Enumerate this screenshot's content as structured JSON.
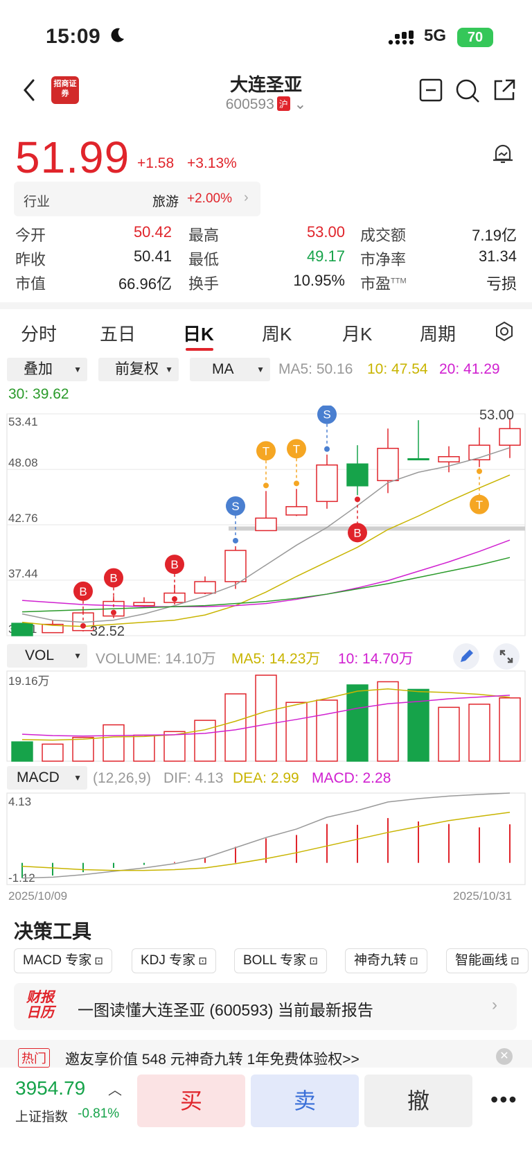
{
  "status_bar": {
    "time": "15:09",
    "network": "5G",
    "battery": "70"
  },
  "header": {
    "stock_name": "大连圣亚",
    "stock_code": "600593",
    "exchange_badge": "沪",
    "broker_logo": "招商证券"
  },
  "quote": {
    "price": "51.99",
    "change": "+1.58",
    "change_pct": "+3.13%",
    "industry": {
      "label": "行业",
      "name": "旅游",
      "pct": "+2.00%"
    },
    "stats": [
      {
        "label": "今开",
        "value": "50.42",
        "color": "#e0242b"
      },
      {
        "label": "最高",
        "value": "53.00",
        "color": "#e0242b"
      },
      {
        "label": "成交额",
        "value": "7.19亿",
        "color": "#222222"
      },
      {
        "label": "昨收",
        "value": "50.41",
        "color": "#222222"
      },
      {
        "label": "最低",
        "value": "49.17",
        "color": "#16a34a"
      },
      {
        "label": "市净率",
        "value": "31.34",
        "color": "#222222"
      },
      {
        "label": "市值",
        "value": "66.96亿",
        "color": "#222222"
      },
      {
        "label": "换手",
        "value": "10.95%",
        "color": "#222222"
      },
      {
        "label": "市盈",
        "value": "亏损",
        "color": "#222222",
        "sup": "TTM"
      }
    ]
  },
  "tabs": [
    "分时",
    "五日",
    "日K",
    "周K",
    "月K",
    "周期"
  ],
  "active_tab": "日K",
  "controls": {
    "overlay": "叠加",
    "adjust": "前复权",
    "indicator": "MA"
  },
  "ma_legend": {
    "ma5": "MA5: 50.16",
    "ma10": "10: 47.54",
    "ma20": "20: 41.29",
    "ma30": "30: 39.62",
    "colors": {
      "ma5": "#999999",
      "ma10": "#c8b400",
      "ma20": "#d020d0",
      "ma30": "#2a9a2a"
    }
  },
  "chart_data": [
    {
      "type": "candlestick",
      "title": "日K",
      "x_range": [
        "2025/10/09",
        "2025/10/31"
      ],
      "ylim": [
        32.11,
        53.41
      ],
      "y_ticks": [
        "53.41",
        "48.08",
        "42.76",
        "37.44",
        "32.11"
      ],
      "annotations": {
        "high_label": "53.00",
        "low_label": "32.52"
      },
      "candles": [
        {
          "o": 32.11,
          "c": 33.3,
          "h": 33.3,
          "l": 32.11,
          "up": false
        },
        {
          "o": 32.4,
          "c": 33.2,
          "h": 33.6,
          "l": 32.4,
          "up": true
        },
        {
          "o": 32.6,
          "c": 34.3,
          "h": 34.6,
          "l": 32.52,
          "up": true
        },
        {
          "o": 34.0,
          "c": 35.4,
          "h": 35.9,
          "l": 33.8,
          "up": true
        },
        {
          "o": 35.0,
          "c": 35.3,
          "h": 35.8,
          "l": 34.9,
          "up": true
        },
        {
          "o": 35.3,
          "c": 36.2,
          "h": 37.0,
          "l": 35.1,
          "up": true
        },
        {
          "o": 36.2,
          "c": 37.3,
          "h": 37.8,
          "l": 36.1,
          "up": true
        },
        {
          "o": 37.3,
          "c": 40.3,
          "h": 40.7,
          "l": 36.6,
          "up": true
        },
        {
          "o": 42.2,
          "c": 43.4,
          "h": 46.0,
          "l": 42.2,
          "up": true
        },
        {
          "o": 43.7,
          "c": 44.5,
          "h": 46.2,
          "l": 43.6,
          "up": true
        },
        {
          "o": 45.0,
          "c": 48.5,
          "h": 49.5,
          "l": 44.3,
          "up": true
        },
        {
          "o": 48.6,
          "c": 46.5,
          "h": 50.4,
          "l": 45.6,
          "up": false
        },
        {
          "o": 47.0,
          "c": 50.1,
          "h": 52.0,
          "l": 45.8,
          "up": true
        },
        {
          "o": 49.1,
          "c": 49.0,
          "h": 52.8,
          "l": 49.0,
          "up": false
        },
        {
          "o": 48.8,
          "c": 49.3,
          "h": 50.3,
          "l": 47.8,
          "up": true
        },
        {
          "o": 49.0,
          "c": 50.4,
          "h": 52.1,
          "l": 48.3,
          "up": true
        },
        {
          "o": 50.4,
          "c": 51.99,
          "h": 53.0,
          "l": 49.17,
          "up": true
        }
      ],
      "series": [
        {
          "name": "MA5",
          "color": "#999999",
          "values": [
            34.2,
            33.6,
            33.4,
            33.6,
            34.2,
            35.0,
            35.9,
            37.0,
            38.9,
            40.8,
            42.5,
            44.6,
            46.8,
            47.8,
            48.4,
            49.2,
            50.16
          ]
        },
        {
          "name": "10",
          "color": "#c8b400",
          "values": [
            33.4,
            33.1,
            33.0,
            33.2,
            33.4,
            33.6,
            34.1,
            35.0,
            36.3,
            37.8,
            39.2,
            40.6,
            42.3,
            43.6,
            45.0,
            46.3,
            47.54
          ]
        },
        {
          "name": "20",
          "color": "#d020d0",
          "values": [
            35.5,
            35.3,
            35.1,
            35.0,
            34.9,
            34.9,
            34.9,
            35.0,
            35.2,
            35.6,
            36.1,
            36.7,
            37.4,
            38.3,
            39.2,
            40.2,
            41.29
          ]
        },
        {
          "name": "30",
          "color": "#2a9a2a",
          "values": [
            34.4,
            34.5,
            34.6,
            34.7,
            34.8,
            34.9,
            35.0,
            35.2,
            35.4,
            35.7,
            36.1,
            36.6,
            37.1,
            37.7,
            38.3,
            38.9,
            39.62
          ]
        }
      ],
      "signals": [
        {
          "i": 2,
          "label": "B"
        },
        {
          "i": 3,
          "label": "B"
        },
        {
          "i": 5,
          "label": "B"
        },
        {
          "i": 7,
          "label": "S"
        },
        {
          "i": 8,
          "label": "T"
        },
        {
          "i": 9,
          "label": "T"
        },
        {
          "i": 10,
          "label": "S"
        },
        {
          "i": 11,
          "label": "B"
        },
        {
          "i": 15,
          "label": "T"
        }
      ]
    },
    {
      "type": "bar",
      "title": "VOL",
      "legend": [
        "VOLUME: 14.10万",
        "MA5: 14.23万",
        "10: 14.70万"
      ],
      "y_top_label": "19.16万",
      "ylim": [
        0,
        19.16
      ],
      "values": [
        4.3,
        3.8,
        5.3,
        8.1,
        5.8,
        6.6,
        9.1,
        15.0,
        19.16,
        13.1,
        13.6,
        17.0,
        17.7,
        16.0,
        12.0,
        12.7,
        14.1
      ],
      "up": [
        false,
        true,
        true,
        true,
        true,
        true,
        true,
        true,
        true,
        true,
        true,
        false,
        true,
        false,
        true,
        true,
        true
      ],
      "series": [
        {
          "name": "MA5",
          "color": "#c8b400",
          "values": [
            4.8,
            4.7,
            4.9,
            5.4,
            5.5,
            5.9,
            7.0,
            8.9,
            11.1,
            12.6,
            14.0,
            15.6,
            16.1,
            15.5,
            15.3,
            14.9,
            14.23
          ]
        },
        {
          "name": "10",
          "color": "#d020d0",
          "values": [
            6.0,
            5.7,
            5.6,
            5.7,
            5.8,
            5.9,
            6.2,
            7.0,
            8.2,
            9.3,
            10.5,
            11.8,
            12.8,
            13.3,
            13.9,
            14.3,
            14.7
          ]
        }
      ]
    },
    {
      "type": "bar",
      "title": "MACD",
      "legend": [
        "(12,26,9)",
        "DIF: 4.13",
        "DEA: 2.99",
        "MACD: 2.28"
      ],
      "ylim": [
        -1.12,
        4.13
      ],
      "y_ticks": [
        "4.13",
        "-1.12"
      ],
      "values": [
        -0.9,
        -0.75,
        -0.55,
        -0.3,
        -0.12,
        0.05,
        0.3,
        0.95,
        1.45,
        1.65,
        2.3,
        2.25,
        2.65,
        2.45,
        2.3,
        2.1,
        2.28
      ],
      "series": [
        {
          "name": "DIF",
          "color": "#999999",
          "values": [
            -0.9,
            -0.85,
            -0.7,
            -0.5,
            -0.3,
            -0.05,
            0.3,
            0.9,
            1.5,
            2.0,
            2.7,
            3.1,
            3.6,
            3.8,
            3.95,
            4.05,
            4.13
          ]
        },
        {
          "name": "DEA",
          "color": "#c8b400",
          "values": [
            -0.2,
            -0.3,
            -0.4,
            -0.45,
            -0.45,
            -0.4,
            -0.3,
            -0.05,
            0.25,
            0.6,
            1.0,
            1.4,
            1.8,
            2.15,
            2.5,
            2.75,
            2.99
          ]
        }
      ]
    }
  ],
  "sub_indicators": {
    "vol": "VOL",
    "macd": "MACD"
  },
  "date_start": "2025/10/09",
  "date_end": "2025/10/31",
  "tools": {
    "title": "决策工具",
    "chips": [
      "MACD 专家",
      "KDJ 专家",
      "BOLL 专家",
      "神奇九转",
      "智能画线"
    ]
  },
  "report": {
    "logo_line1": "财报",
    "logo_line2": "日历",
    "text": "一图读懂大连圣亚 (600593) 当前最新报告"
  },
  "hot": {
    "tag": "热门",
    "text": "邀友享价值 548 元神奇九转 1年免费体验权>>"
  },
  "bottom": {
    "index_value": "3954.79",
    "index_name": "上证指数",
    "index_pct": "-0.81%",
    "buy": "买",
    "sell": "卖",
    "cancel": "撤",
    "more": "•••"
  }
}
